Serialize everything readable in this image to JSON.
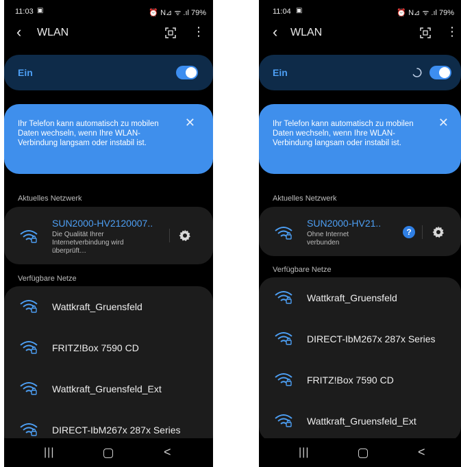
{
  "screens": [
    {
      "status": {
        "time": "11:03",
        "notif_icon": "▣",
        "icons": "⏰ N⊿ ᯤ .ıl",
        "battery": "79%"
      },
      "appbar": {
        "back_icon": "‹",
        "title": "WLAN",
        "qr_icon": "qr-scan-icon",
        "more_icon": "⋮"
      },
      "master": {
        "label": "Ein",
        "toggle_on": true,
        "spinner": false
      },
      "tip": {
        "text": "Ihr Telefon kann automatisch zu mobilen Daten wechseln, wenn Ihre WLAN-Verbindung langsam oder instabil ist.",
        "close_icon": "✕"
      },
      "current_section": "Aktuelles Netzwerk",
      "current": {
        "name": "SUN2000-HV2120007..",
        "status": "Die Qualität Ihrer Internetverbindung wird überprüft…",
        "help": false
      },
      "available_section": "Verfügbare Netze",
      "available": [
        {
          "name": "Wattkraft_Gruensfeld"
        },
        {
          "name": "FRITZ!Box 7590 CD"
        },
        {
          "name": "Wattkraft_Gruensfeld_Ext"
        },
        {
          "name": "DIRECT-IbM267x 287x Series"
        }
      ],
      "nav": {
        "recent_icon": "|||",
        "home_icon": "home-icon",
        "back_icon": "<"
      }
    },
    {
      "status": {
        "time": "11:04",
        "notif_icon": "▣",
        "icons": "⏰ N⊿ ᯤ .ıl",
        "battery": "79%"
      },
      "appbar": {
        "back_icon": "‹",
        "title": "WLAN",
        "qr_icon": "qr-scan-icon",
        "more_icon": "⋮"
      },
      "master": {
        "label": "Ein",
        "toggle_on": true,
        "spinner": true
      },
      "tip": {
        "text": "Ihr Telefon kann automatisch zu mobilen Daten wechseln, wenn Ihre WLAN-Verbindung langsam oder instabil ist.",
        "close_icon": "✕"
      },
      "current_section": "Aktuelles Netzwerk",
      "current": {
        "name": "SUN2000-HV21..",
        "status": "Ohne Internet verbunden",
        "help": true,
        "help_glyph": "?"
      },
      "available_section": "Verfügbare Netze",
      "available": [
        {
          "name": "Wattkraft_Gruensfeld"
        },
        {
          "name": "DIRECT-IbM267x 287x Series"
        },
        {
          "name": "FRITZ!Box 7590 CD"
        },
        {
          "name": "Wattkraft_Gruensfeld_Ext"
        }
      ],
      "nav": {
        "recent_icon": "|||",
        "home_icon": "home-icon",
        "back_icon": "<"
      }
    }
  ],
  "colors": {
    "accent": "#3d8ef0",
    "link_blue": "#4d9ff4",
    "tip_bg": "#3f8fec",
    "card_bg": "#1c1c1c",
    "master_bg": "#0e2b49"
  }
}
